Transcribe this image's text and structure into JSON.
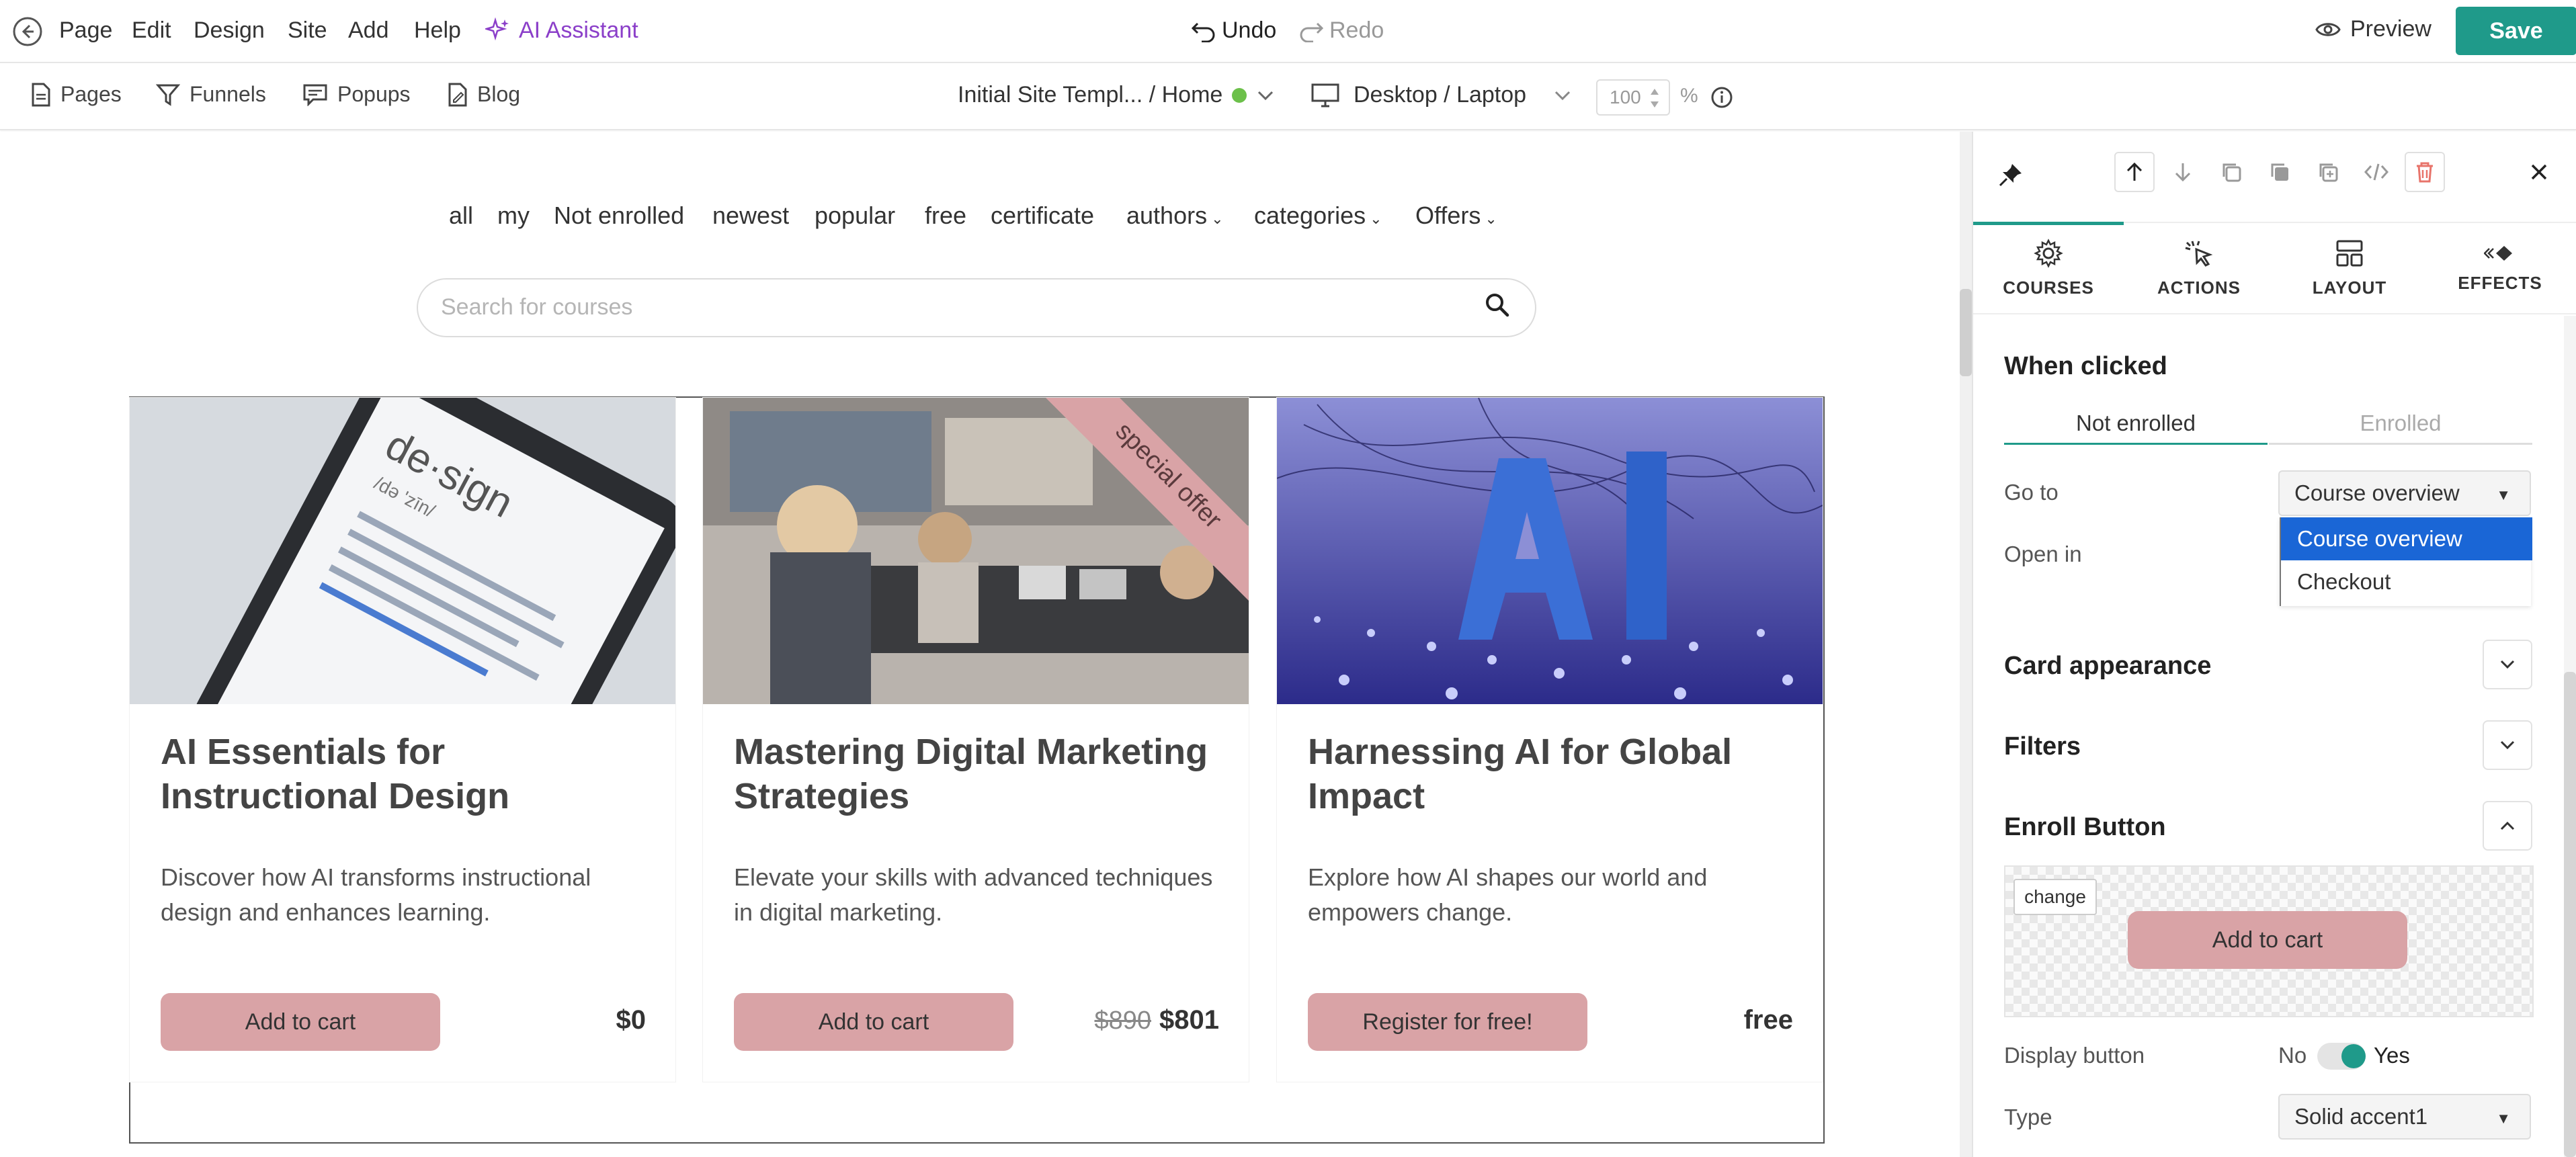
{
  "topbar": {
    "menu": [
      {
        "label": "Page"
      },
      {
        "label": "Edit"
      },
      {
        "label": "Design"
      },
      {
        "label": "Site"
      },
      {
        "label": "Add"
      },
      {
        "label": "Help"
      }
    ],
    "ai_assistant": "AI Assistant",
    "undo": "Undo",
    "redo": "Redo",
    "preview": "Preview",
    "save": "Save"
  },
  "subbar": {
    "nav": [
      {
        "label": "Pages",
        "icon": "page-icon"
      },
      {
        "label": "Funnels",
        "icon": "funnel-icon"
      },
      {
        "label": "Popups",
        "icon": "popup-icon"
      },
      {
        "label": "Blog",
        "icon": "blog-icon"
      }
    ],
    "page_selector": "Initial Site Templ... / Home",
    "device": "Desktop / Laptop",
    "zoom": "100",
    "zoom_unit": "%"
  },
  "canvas": {
    "filters": [
      {
        "label": "all"
      },
      {
        "label": "my"
      },
      {
        "label": "Not enrolled"
      },
      {
        "label": "newest"
      },
      {
        "label": "popular"
      },
      {
        "label": "free"
      },
      {
        "label": "certificate"
      },
      {
        "label": "authors",
        "dropdown": true
      },
      {
        "label": "categories",
        "dropdown": true
      },
      {
        "label": "Offers",
        "dropdown": true
      }
    ],
    "search_placeholder": "Search for courses",
    "cards": [
      {
        "title": "AI Essentials for Instructional Design",
        "description": "Discover how AI transforms instructional design and enhances learning.",
        "button": "Add to cart",
        "price": "$0"
      },
      {
        "title": "Mastering Digital Marketing Strategies",
        "description": "Elevate your skills with advanced techniques in digital marketing.",
        "button": "Add to cart",
        "old_price": "$890",
        "price": "$801",
        "ribbon": "special offer"
      },
      {
        "title": "Harnessing AI for Global Impact",
        "description": "Explore how AI shapes our world and empowers change.",
        "button": "Register for free!",
        "price": "free"
      }
    ]
  },
  "panel": {
    "tabs": [
      {
        "label": "COURSES",
        "icon": "gear-icon",
        "active": true
      },
      {
        "label": "ACTIONS",
        "icon": "cursor-click-icon"
      },
      {
        "label": "LAYOUT",
        "icon": "layout-icon"
      },
      {
        "label": "EFFECTS",
        "icon": "effects-icon"
      }
    ],
    "when_clicked": "When clicked",
    "segments": [
      "Not enrolled",
      "Enrolled"
    ],
    "go_to_label": "Go to",
    "go_to_value": "Course overview",
    "open_in_label": "Open in",
    "dropdown_options": [
      "Course overview",
      "Checkout"
    ],
    "sections": {
      "card_appearance": "Card appearance",
      "filters": "Filters",
      "enroll_button": "Enroll Button"
    },
    "change": "change",
    "preview_button": "Add to cart",
    "display_button_label": "Display button",
    "display_no": "No",
    "display_yes": "Yes",
    "type_label": "Type",
    "type_value": "Solid accent1"
  },
  "colors": {
    "accent": "#1f9a8a",
    "button_pink": "#d9a3a6",
    "ai_purple": "#8b3fc9",
    "select_highlight": "#1a66d6"
  }
}
